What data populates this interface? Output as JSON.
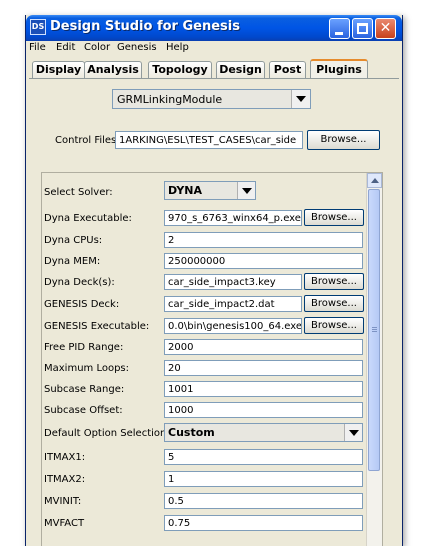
{
  "window": {
    "title": "Design Studio for Genesis",
    "icon_text": "DS",
    "close_glyph": "✕"
  },
  "menu": {
    "items": [
      "File",
      "Edit",
      "Color",
      "Genesis",
      "Help"
    ]
  },
  "tabs": {
    "items": [
      "Display",
      "Analysis",
      "Topology",
      "Design",
      "Post",
      "Plugins"
    ],
    "active": "Plugins"
  },
  "module": {
    "selected": "GRMLinkingModule"
  },
  "control_files": {
    "label": "Control Files:",
    "value": "1ARKING\\ESL\\TEST_CASES\\car_side",
    "browse_label": "Browse..."
  },
  "form": {
    "solver": {
      "label": "Select Solver:",
      "value": "DYNA"
    },
    "dyna_executable": {
      "label": "Dyna Executable:",
      "value": "970_s_6763_winx64_p.exe",
      "browse_label": "Browse..."
    },
    "dyna_cpus": {
      "label": "Dyna CPUs:",
      "value": "2"
    },
    "dyna_mem": {
      "label": "Dyna MEM:",
      "value": "250000000"
    },
    "dyna_decks": {
      "label": "Dyna Deck(s):",
      "value": "car_side_impact3.key",
      "browse_label": "Browse..."
    },
    "genesis_deck": {
      "label": "GENESIS Deck:",
      "value": "car_side_impact2.dat",
      "browse_label": "Browse..."
    },
    "genesis_executable": {
      "label": "GENESIS Executable:",
      "value": "0.0\\bin\\genesis100_64.exe",
      "browse_label": "Browse..."
    },
    "free_pid_range": {
      "label": "Free PID Range:",
      "value": "2000"
    },
    "maximum_loops": {
      "label": "Maximum Loops:",
      "value": "20"
    },
    "subcase_range": {
      "label": "Subcase Range:",
      "value": "1001"
    },
    "subcase_offset": {
      "label": "Subcase Offset:",
      "value": "1000"
    },
    "default_option": {
      "label": "Default Option Selection:",
      "value": "Custom"
    },
    "itmax1": {
      "label": "ITMAX1:",
      "value": "5"
    },
    "itmax2": {
      "label": "ITMAX2:",
      "value": "1"
    },
    "mvinit": {
      "label": "MVINIT:",
      "value": "0.5"
    },
    "mvfact": {
      "label": "MVFACT",
      "value": "0.75"
    }
  }
}
